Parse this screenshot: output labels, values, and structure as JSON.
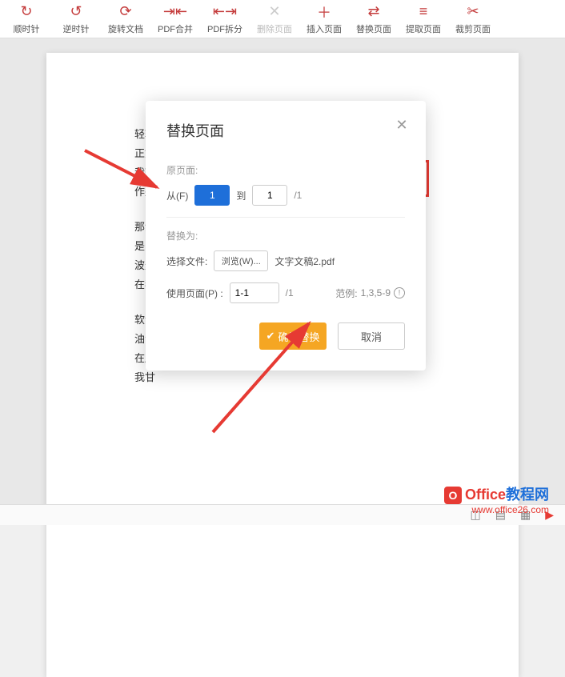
{
  "toolbar": [
    {
      "label": "顺时针",
      "icon": "↻"
    },
    {
      "label": "逆时针",
      "icon": "↺"
    },
    {
      "label": "旋转文档",
      "icon": "⟳"
    },
    {
      "label": "PDF合并",
      "icon": "⇥⇤"
    },
    {
      "label": "PDF拆分",
      "icon": "⇤⇥"
    },
    {
      "label": "删除页面",
      "icon": "✕",
      "disabled": true
    },
    {
      "label": "插入页面",
      "icon": "＋"
    },
    {
      "label": "替换页面",
      "icon": "⇄"
    },
    {
      "label": "提取页面",
      "icon": "≡"
    },
    {
      "label": "裁剪页面",
      "icon": "✂"
    }
  ],
  "doc": {
    "l1": "轻轻",
    "l2": "正如",
    "l3": "我轻",
    "l4": "作别",
    "l5": "那河",
    "l6": "是",
    "l7": "波光",
    "l8": "在我",
    "l9": "软泥",
    "l10": "油油",
    "l11": "在康",
    "l12": "我甘"
  },
  "modal": {
    "title": "替换页面",
    "section1": "原页面:",
    "from_label": "从(F)",
    "from_value": "1",
    "to_label": "到",
    "to_value": "1",
    "total_suffix": "/1",
    "section2": "替换为:",
    "select_file_label": "选择文件:",
    "browse_label": "浏览(W)...",
    "selected_file": "文字文稿2.pdf",
    "use_page_label": "使用页面(P)  :",
    "use_page_value": "1-1",
    "use_page_suffix": "/1",
    "example_label": "范例:",
    "example_value": "1,3,5-9",
    "confirm_label": "确认替换",
    "cancel_label": "取消"
  },
  "watermark": {
    "text1a": "Office",
    "text1b": "教程网",
    "text2": "www.office26.com"
  }
}
